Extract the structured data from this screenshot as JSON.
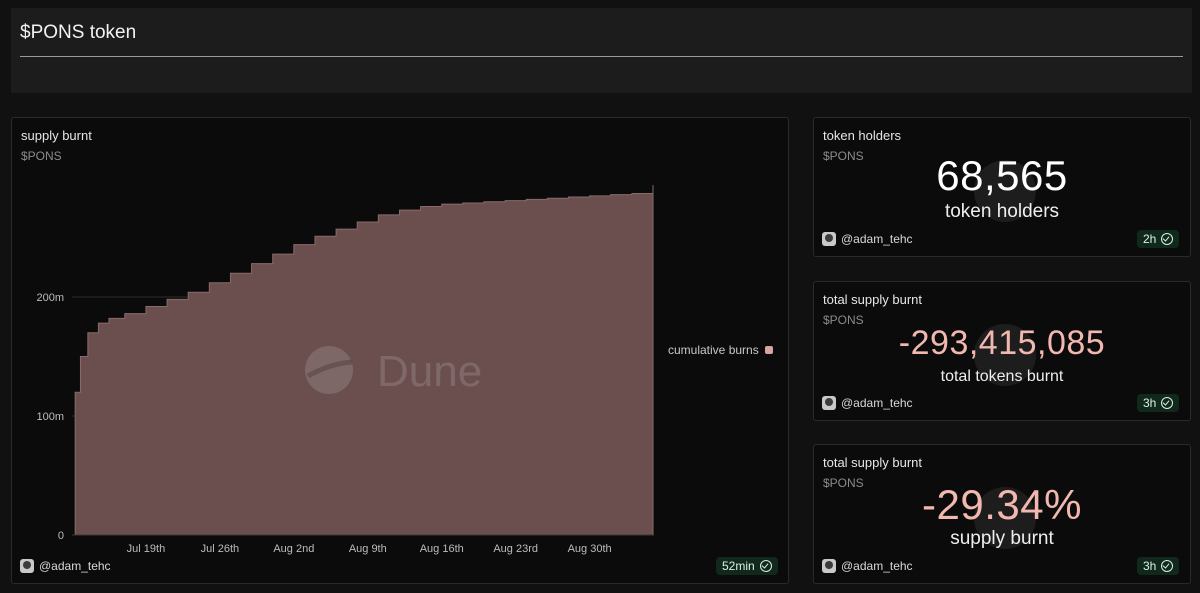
{
  "dashboard": {
    "title": "$PONS token"
  },
  "supply_chart": {
    "title": "supply burnt",
    "subtitle": "$PONS",
    "legend_label": "cumulative burns",
    "author": "@adam_tehc",
    "refresh": "52min",
    "watermark": "Dune",
    "series_color": "#6b4f4f",
    "swatch_color": "#d8a3a0"
  },
  "holders_counter": {
    "title": "token holders",
    "subtitle": "$PONS",
    "value": "68,565",
    "label": "token holders",
    "author": "@adam_tehc",
    "refresh": "2h",
    "value_color": "#ffffff"
  },
  "burnt_counter": {
    "title": "total supply burnt",
    "subtitle": "$PONS",
    "value": "-293,415,085",
    "label": "total tokens burnt",
    "author": "@adam_tehc",
    "refresh": "3h",
    "value_color": "#f2b8b0"
  },
  "percent_counter": {
    "title": "total supply burnt",
    "subtitle": "$PONS",
    "value": "-29.34%",
    "label": "supply burnt",
    "author": "@adam_tehc",
    "refresh": "3h",
    "value_color": "#f2b8b0"
  },
  "chart_data": {
    "type": "area",
    "title": "supply burnt",
    "subtitle": "$PONS",
    "xlabel": "",
    "ylabel": "",
    "x_tick_labels": [
      "Jul 19th",
      "Jul 26th",
      "Aug 2nd",
      "Aug 9th",
      "Aug 16th",
      "Aug 23rd",
      "Aug 30th"
    ],
    "y_tick_labels": [
      "0",
      "100m",
      "200m"
    ],
    "ylim": [
      0,
      300
    ],
    "y_unit": "m",
    "x_unit": "days since first point (Jul 12th)",
    "grid": true,
    "legend": "right",
    "series": [
      {
        "name": "cumulative burns",
        "x": [
          0,
          0.3,
          0.8,
          1.5,
          2.5,
          3.5,
          5,
          7,
          9,
          11,
          13,
          15,
          17,
          19,
          21,
          23,
          25,
          27,
          29,
          31,
          33,
          35,
          37,
          39,
          41,
          43,
          45,
          47,
          49,
          51,
          53,
          55
        ],
        "values": [
          0,
          120,
          150,
          170,
          178,
          182,
          186,
          192,
          198,
          204,
          212,
          220,
          228,
          236,
          244,
          251,
          257,
          263,
          269,
          273,
          276,
          278,
          279,
          280,
          281,
          282,
          283,
          284,
          285,
          286,
          287,
          294
        ]
      }
    ]
  }
}
